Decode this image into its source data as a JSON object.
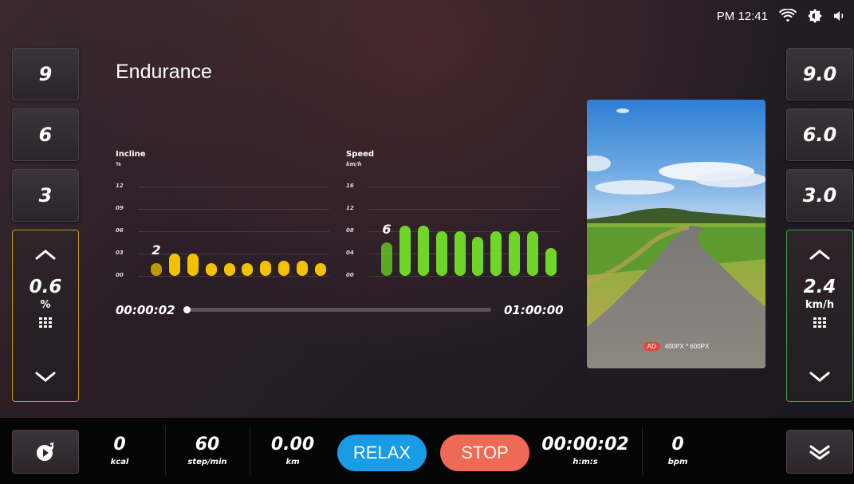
{
  "status_bar": {
    "time": "PM 12:41",
    "icons": [
      "wifi-icon",
      "brightness-icon",
      "volume-icon"
    ]
  },
  "title": "Endurance",
  "incline_presets": [
    "9",
    "6",
    "3"
  ],
  "speed_presets": [
    "9.0",
    "6.0",
    "3.0"
  ],
  "incline_control": {
    "value": "0.6",
    "unit": "%",
    "color": "#c9951d"
  },
  "speed_control": {
    "value": "2.4",
    "unit": "km/h",
    "color": "#3aa34a"
  },
  "chart_data": [
    {
      "type": "bar",
      "title": "Incline",
      "ylabel": "%",
      "yticks": [
        "12",
        "09",
        "06",
        "03",
        "00"
      ],
      "ylim": [
        0,
        12
      ],
      "current_label": "2",
      "current_index": 0,
      "values": [
        1,
        3,
        3,
        1,
        1,
        1,
        2,
        2,
        2,
        1
      ],
      "color": "#f2c200"
    },
    {
      "type": "bar",
      "title": "Speed",
      "ylabel": "km/h",
      "yticks": [
        "16",
        "12",
        "08",
        "04",
        "00"
      ],
      "ylim": [
        0,
        16
      ],
      "current_label": "6",
      "current_index": 0,
      "values": [
        6,
        9,
        9,
        8,
        8,
        7,
        8,
        8,
        8,
        5
      ],
      "color": "#6fd629"
    }
  ],
  "progress": {
    "elapsed": "00:00:02",
    "total": "01:00:00",
    "fraction": 0.0006
  },
  "ad": {
    "badge": "AD",
    "size_text": "400PX * 600PX"
  },
  "bottom": {
    "calories": {
      "value": "0",
      "unit": "kcal"
    },
    "cadence": {
      "value": "60",
      "unit": "step/min"
    },
    "distance": {
      "value": "0.00",
      "unit": "km"
    },
    "relax_label": "RELAX",
    "stop_label": "STOP",
    "time": {
      "value": "00:00:02",
      "unit": "h:m:s"
    },
    "heart_rate": {
      "value": "0",
      "unit": "bpm"
    },
    "relax_color": "#1a9be6",
    "stop_color": "#ee6a55"
  }
}
